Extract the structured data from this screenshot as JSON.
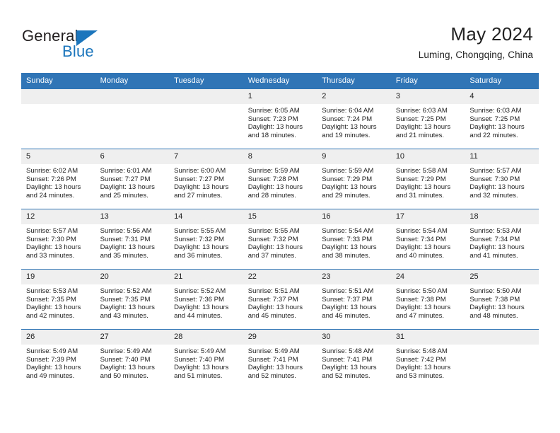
{
  "brand": {
    "name_part1": "General",
    "name_part2": "Blue"
  },
  "header": {
    "month_title": "May 2024",
    "location": "Luming, Chongqing, China"
  },
  "colors": {
    "header_blue": "#3075b6",
    "grid_line_blue": "#2e74b5",
    "daynum_band": "#efefef",
    "logo_blue": "#1b75bc",
    "text": "#222222"
  },
  "weekday_headers": [
    "Sunday",
    "Monday",
    "Tuesday",
    "Wednesday",
    "Thursday",
    "Friday",
    "Saturday"
  ],
  "weeks": [
    [
      {
        "empty": true,
        "day": "",
        "sunrise": "",
        "sunset": "",
        "daylight_line1": "",
        "daylight_line2": ""
      },
      {
        "empty": true,
        "day": "",
        "sunrise": "",
        "sunset": "",
        "daylight_line1": "",
        "daylight_line2": ""
      },
      {
        "empty": true,
        "day": "",
        "sunrise": "",
        "sunset": "",
        "daylight_line1": "",
        "daylight_line2": ""
      },
      {
        "empty": false,
        "day": "1",
        "sunrise": "Sunrise: 6:05 AM",
        "sunset": "Sunset: 7:23 PM",
        "daylight_line1": "Daylight: 13 hours",
        "daylight_line2": "and 18 minutes."
      },
      {
        "empty": false,
        "day": "2",
        "sunrise": "Sunrise: 6:04 AM",
        "sunset": "Sunset: 7:24 PM",
        "daylight_line1": "Daylight: 13 hours",
        "daylight_line2": "and 19 minutes."
      },
      {
        "empty": false,
        "day": "3",
        "sunrise": "Sunrise: 6:03 AM",
        "sunset": "Sunset: 7:25 PM",
        "daylight_line1": "Daylight: 13 hours",
        "daylight_line2": "and 21 minutes."
      },
      {
        "empty": false,
        "day": "4",
        "sunrise": "Sunrise: 6:03 AM",
        "sunset": "Sunset: 7:25 PM",
        "daylight_line1": "Daylight: 13 hours",
        "daylight_line2": "and 22 minutes."
      }
    ],
    [
      {
        "empty": false,
        "day": "5",
        "sunrise": "Sunrise: 6:02 AM",
        "sunset": "Sunset: 7:26 PM",
        "daylight_line1": "Daylight: 13 hours",
        "daylight_line2": "and 24 minutes."
      },
      {
        "empty": false,
        "day": "6",
        "sunrise": "Sunrise: 6:01 AM",
        "sunset": "Sunset: 7:27 PM",
        "daylight_line1": "Daylight: 13 hours",
        "daylight_line2": "and 25 minutes."
      },
      {
        "empty": false,
        "day": "7",
        "sunrise": "Sunrise: 6:00 AM",
        "sunset": "Sunset: 7:27 PM",
        "daylight_line1": "Daylight: 13 hours",
        "daylight_line2": "and 27 minutes."
      },
      {
        "empty": false,
        "day": "8",
        "sunrise": "Sunrise: 5:59 AM",
        "sunset": "Sunset: 7:28 PM",
        "daylight_line1": "Daylight: 13 hours",
        "daylight_line2": "and 28 minutes."
      },
      {
        "empty": false,
        "day": "9",
        "sunrise": "Sunrise: 5:59 AM",
        "sunset": "Sunset: 7:29 PM",
        "daylight_line1": "Daylight: 13 hours",
        "daylight_line2": "and 29 minutes."
      },
      {
        "empty": false,
        "day": "10",
        "sunrise": "Sunrise: 5:58 AM",
        "sunset": "Sunset: 7:29 PM",
        "daylight_line1": "Daylight: 13 hours",
        "daylight_line2": "and 31 minutes."
      },
      {
        "empty": false,
        "day": "11",
        "sunrise": "Sunrise: 5:57 AM",
        "sunset": "Sunset: 7:30 PM",
        "daylight_line1": "Daylight: 13 hours",
        "daylight_line2": "and 32 minutes."
      }
    ],
    [
      {
        "empty": false,
        "day": "12",
        "sunrise": "Sunrise: 5:57 AM",
        "sunset": "Sunset: 7:30 PM",
        "daylight_line1": "Daylight: 13 hours",
        "daylight_line2": "and 33 minutes."
      },
      {
        "empty": false,
        "day": "13",
        "sunrise": "Sunrise: 5:56 AM",
        "sunset": "Sunset: 7:31 PM",
        "daylight_line1": "Daylight: 13 hours",
        "daylight_line2": "and 35 minutes."
      },
      {
        "empty": false,
        "day": "14",
        "sunrise": "Sunrise: 5:55 AM",
        "sunset": "Sunset: 7:32 PM",
        "daylight_line1": "Daylight: 13 hours",
        "daylight_line2": "and 36 minutes."
      },
      {
        "empty": false,
        "day": "15",
        "sunrise": "Sunrise: 5:55 AM",
        "sunset": "Sunset: 7:32 PM",
        "daylight_line1": "Daylight: 13 hours",
        "daylight_line2": "and 37 minutes."
      },
      {
        "empty": false,
        "day": "16",
        "sunrise": "Sunrise: 5:54 AM",
        "sunset": "Sunset: 7:33 PM",
        "daylight_line1": "Daylight: 13 hours",
        "daylight_line2": "and 38 minutes."
      },
      {
        "empty": false,
        "day": "17",
        "sunrise": "Sunrise: 5:54 AM",
        "sunset": "Sunset: 7:34 PM",
        "daylight_line1": "Daylight: 13 hours",
        "daylight_line2": "and 40 minutes."
      },
      {
        "empty": false,
        "day": "18",
        "sunrise": "Sunrise: 5:53 AM",
        "sunset": "Sunset: 7:34 PM",
        "daylight_line1": "Daylight: 13 hours",
        "daylight_line2": "and 41 minutes."
      }
    ],
    [
      {
        "empty": false,
        "day": "19",
        "sunrise": "Sunrise: 5:53 AM",
        "sunset": "Sunset: 7:35 PM",
        "daylight_line1": "Daylight: 13 hours",
        "daylight_line2": "and 42 minutes."
      },
      {
        "empty": false,
        "day": "20",
        "sunrise": "Sunrise: 5:52 AM",
        "sunset": "Sunset: 7:35 PM",
        "daylight_line1": "Daylight: 13 hours",
        "daylight_line2": "and 43 minutes."
      },
      {
        "empty": false,
        "day": "21",
        "sunrise": "Sunrise: 5:52 AM",
        "sunset": "Sunset: 7:36 PM",
        "daylight_line1": "Daylight: 13 hours",
        "daylight_line2": "and 44 minutes."
      },
      {
        "empty": false,
        "day": "22",
        "sunrise": "Sunrise: 5:51 AM",
        "sunset": "Sunset: 7:37 PM",
        "daylight_line1": "Daylight: 13 hours",
        "daylight_line2": "and 45 minutes."
      },
      {
        "empty": false,
        "day": "23",
        "sunrise": "Sunrise: 5:51 AM",
        "sunset": "Sunset: 7:37 PM",
        "daylight_line1": "Daylight: 13 hours",
        "daylight_line2": "and 46 minutes."
      },
      {
        "empty": false,
        "day": "24",
        "sunrise": "Sunrise: 5:50 AM",
        "sunset": "Sunset: 7:38 PM",
        "daylight_line1": "Daylight: 13 hours",
        "daylight_line2": "and 47 minutes."
      },
      {
        "empty": false,
        "day": "25",
        "sunrise": "Sunrise: 5:50 AM",
        "sunset": "Sunset: 7:38 PM",
        "daylight_line1": "Daylight: 13 hours",
        "daylight_line2": "and 48 minutes."
      }
    ],
    [
      {
        "empty": false,
        "day": "26",
        "sunrise": "Sunrise: 5:49 AM",
        "sunset": "Sunset: 7:39 PM",
        "daylight_line1": "Daylight: 13 hours",
        "daylight_line2": "and 49 minutes."
      },
      {
        "empty": false,
        "day": "27",
        "sunrise": "Sunrise: 5:49 AM",
        "sunset": "Sunset: 7:40 PM",
        "daylight_line1": "Daylight: 13 hours",
        "daylight_line2": "and 50 minutes."
      },
      {
        "empty": false,
        "day": "28",
        "sunrise": "Sunrise: 5:49 AM",
        "sunset": "Sunset: 7:40 PM",
        "daylight_line1": "Daylight: 13 hours",
        "daylight_line2": "and 51 minutes."
      },
      {
        "empty": false,
        "day": "29",
        "sunrise": "Sunrise: 5:49 AM",
        "sunset": "Sunset: 7:41 PM",
        "daylight_line1": "Daylight: 13 hours",
        "daylight_line2": "and 52 minutes."
      },
      {
        "empty": false,
        "day": "30",
        "sunrise": "Sunrise: 5:48 AM",
        "sunset": "Sunset: 7:41 PM",
        "daylight_line1": "Daylight: 13 hours",
        "daylight_line2": "and 52 minutes."
      },
      {
        "empty": false,
        "day": "31",
        "sunrise": "Sunrise: 5:48 AM",
        "sunset": "Sunset: 7:42 PM",
        "daylight_line1": "Daylight: 13 hours",
        "daylight_line2": "and 53 minutes."
      },
      {
        "empty": true,
        "day": "",
        "sunrise": "",
        "sunset": "",
        "daylight_line1": "",
        "daylight_line2": ""
      }
    ]
  ]
}
